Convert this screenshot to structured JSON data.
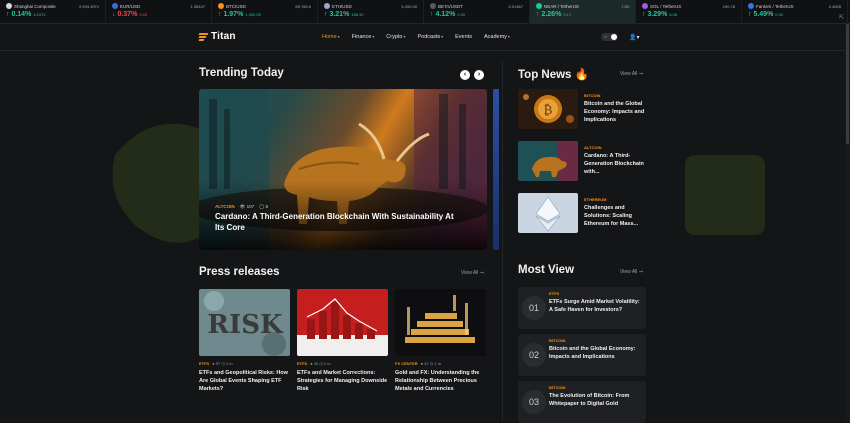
{
  "ticker": [
    {
      "name": "Shanghai Composite",
      "price": "2,993.3972",
      "change": "0.14%",
      "sub": "4.1572",
      "dir": "up",
      "color": "#d8d8d8"
    },
    {
      "name": "EUR/USD",
      "price": "1.08147",
      "change": "0.37%",
      "sub": "0.00",
      "dir": "dn",
      "color": "#3b6fd6"
    },
    {
      "name": "BTC/USD",
      "price": "69,769.0",
      "change": "1.97%",
      "sub": "1,350.00",
      "dir": "up",
      "color": "#f7931a"
    },
    {
      "name": "ETH/USD",
      "price": "5,200.40",
      "change": "3.21%",
      "sub": "158.40",
      "dir": "up",
      "color": "#a0a8c8"
    },
    {
      "name": "BETA/USDT",
      "price": "0.01467",
      "change": "4.12%",
      "sub": "0.00",
      "dir": "up",
      "color": "#5a5a5a"
    },
    {
      "name": "NEAR / TetherUS",
      "price": "7.50",
      "change": "2.26%",
      "sub": "0.17",
      "dir": "up",
      "color": "#1fc69a"
    },
    {
      "name": "SOL / TetherUS",
      "price": "190.78",
      "change": "3.29%",
      "sub": "6.08",
      "dir": "up",
      "color": "#9b5de5"
    },
    {
      "name": "Fantom / TetherUS",
      "price": "0.4605",
      "change": "5.49%",
      "sub": "0.02",
      "dir": "up",
      "color": "#2f7bd8"
    }
  ],
  "logo": {
    "text": "Titan"
  },
  "nav": [
    {
      "label": "Home",
      "active": true,
      "caret": true
    },
    {
      "label": "Finance",
      "caret": true
    },
    {
      "label": "Crypto",
      "caret": true
    },
    {
      "label": "Podcasts",
      "caret": true
    },
    {
      "label": "Events",
      "caret": false
    },
    {
      "label": "Academy",
      "caret": true
    }
  ],
  "trending": {
    "title": "Trending Today",
    "hero": {
      "category": "ALTCOIN",
      "views": "107",
      "comments": "8",
      "title": "Cardano: A Third-Generation Blockchain With Sustainability At Its Core"
    }
  },
  "top_news": {
    "title": "Top News",
    "view_all": "View All",
    "items": [
      {
        "category": "BITCOIN",
        "title": "Bitcoin and the Global Economy: Impacts and Implications"
      },
      {
        "category": "ALTCOIN",
        "title": "Cardano: A Third-Generation Blockchain with..."
      },
      {
        "category": "ETHEREUM",
        "title": "Challenges and Solutions: Scaling Ethereum for Mass..."
      }
    ]
  },
  "press": {
    "title": "Press releases",
    "view_all": "View All",
    "items": [
      {
        "category": "ETFS",
        "views": "57",
        "time": "2 m",
        "title": "ETFs and Geopolitical Risks: How Are Global Events Shaping ETF Markets?",
        "thumb_text": "Risk"
      },
      {
        "category": "ETFS",
        "views": "40",
        "time": "2 m",
        "title": "ETFs and Market Corrections: Strategies for Managing Downside Risk"
      },
      {
        "category": "FX CENTER",
        "views": "57",
        "time": "1 m",
        "title": "Gold and FX: Understanding the Relationship Between Precious Metals and Currencies"
      }
    ]
  },
  "most_view": {
    "title": "Most View",
    "view_all": "View All",
    "items": [
      {
        "num": "01",
        "category": "ETFS",
        "title": "ETFs Surge Amid Market Volatility: A Safe Haven for Investors?"
      },
      {
        "num": "02",
        "category": "BITCOIN",
        "title": "Bitcoin and the Global Economy: Impacts and Implications"
      },
      {
        "num": "03",
        "category": "BITCOIN",
        "title": "The Evolution of Bitcoin: From Whitepaper to Digital Gold"
      }
    ]
  },
  "colors": {
    "accent": "#f7931a",
    "up": "#1fc69a",
    "down": "#f0474f",
    "background": "#141517"
  }
}
